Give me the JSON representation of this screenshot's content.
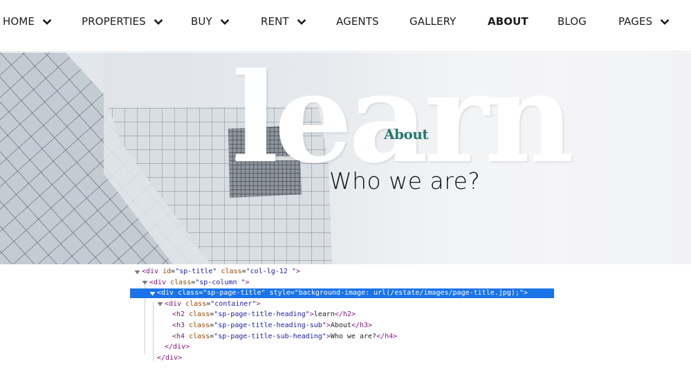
{
  "nav": {
    "items": [
      {
        "label": "HOME",
        "has_dropdown": true,
        "active": false
      },
      {
        "label": "PROPERTIES",
        "has_dropdown": true,
        "active": false
      },
      {
        "label": "BUY",
        "has_dropdown": true,
        "active": false
      },
      {
        "label": "RENT",
        "has_dropdown": true,
        "active": false
      },
      {
        "label": "AGENTS",
        "has_dropdown": false,
        "active": false
      },
      {
        "label": "GALLERY",
        "has_dropdown": false,
        "active": false
      },
      {
        "label": "ABOUT",
        "has_dropdown": false,
        "active": true
      },
      {
        "label": "BLOG",
        "has_dropdown": false,
        "active": false
      },
      {
        "label": "PAGES",
        "has_dropdown": true,
        "active": false
      }
    ],
    "dropdown_icon": "chevron-down-icon"
  },
  "hero": {
    "heading": "learn",
    "heading_sub": "About",
    "sub_heading": "Who we are?",
    "accent_color": "#25796c"
  },
  "devtools": {
    "selected_row": 2,
    "rows": [
      {
        "tag": "div",
        "attrs": [
          [
            "id",
            "sp-title"
          ],
          [
            "class",
            "col-lg-12 "
          ]
        ],
        "text": "",
        "close": false,
        "triangle": "expanded",
        "indent": 0
      },
      {
        "tag": "div",
        "attrs": [
          [
            "class",
            "sp-column "
          ]
        ],
        "text": "",
        "close": false,
        "triangle": "expanded",
        "indent": 1
      },
      {
        "tag": "div",
        "attrs": [
          [
            "class",
            "sp-page-title"
          ],
          [
            "style",
            "background-image: url(/estate/images/page-title.jpg);"
          ]
        ],
        "text": "",
        "close": false,
        "triangle": "expanded",
        "indent": 2
      },
      {
        "tag": "div",
        "attrs": [
          [
            "class",
            "container"
          ]
        ],
        "text": "",
        "close": false,
        "triangle": "expanded",
        "indent": 3
      },
      {
        "tag": "h2",
        "attrs": [
          [
            "class",
            "sp-page-title-heading"
          ]
        ],
        "text": "learn",
        "close": true,
        "triangle": "none",
        "indent": 4
      },
      {
        "tag": "h3",
        "attrs": [
          [
            "class",
            "sp-page-title-heading-sub"
          ]
        ],
        "text": "About",
        "close": true,
        "triangle": "none",
        "indent": 4
      },
      {
        "tag": "h4",
        "attrs": [
          [
            "class",
            "sp-page-title-sub-heading"
          ]
        ],
        "text": "Who we are?",
        "close": true,
        "triangle": "none",
        "indent": 4
      },
      {
        "tag": "/div",
        "attrs": [],
        "text": "",
        "close": false,
        "triangle": "none",
        "indent": 3
      },
      {
        "tag": "/div",
        "attrs": [],
        "text": "",
        "close": false,
        "triangle": "none",
        "indent": 2
      }
    ],
    "selection_color": "#1a73e8"
  }
}
